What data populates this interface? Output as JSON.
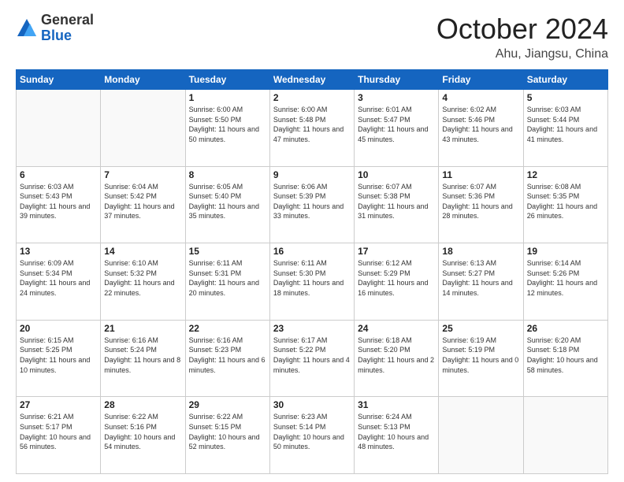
{
  "header": {
    "logo": {
      "general": "General",
      "blue": "Blue"
    },
    "title": "October 2024",
    "location": "Ahu, Jiangsu, China"
  },
  "weekdays": [
    "Sunday",
    "Monday",
    "Tuesday",
    "Wednesday",
    "Thursday",
    "Friday",
    "Saturday"
  ],
  "weeks": [
    [
      {
        "day": "",
        "info": ""
      },
      {
        "day": "",
        "info": ""
      },
      {
        "day": "1",
        "info": "Sunrise: 6:00 AM\nSunset: 5:50 PM\nDaylight: 11 hours and 50 minutes."
      },
      {
        "day": "2",
        "info": "Sunrise: 6:00 AM\nSunset: 5:48 PM\nDaylight: 11 hours and 47 minutes."
      },
      {
        "day": "3",
        "info": "Sunrise: 6:01 AM\nSunset: 5:47 PM\nDaylight: 11 hours and 45 minutes."
      },
      {
        "day": "4",
        "info": "Sunrise: 6:02 AM\nSunset: 5:46 PM\nDaylight: 11 hours and 43 minutes."
      },
      {
        "day": "5",
        "info": "Sunrise: 6:03 AM\nSunset: 5:44 PM\nDaylight: 11 hours and 41 minutes."
      }
    ],
    [
      {
        "day": "6",
        "info": "Sunrise: 6:03 AM\nSunset: 5:43 PM\nDaylight: 11 hours and 39 minutes."
      },
      {
        "day": "7",
        "info": "Sunrise: 6:04 AM\nSunset: 5:42 PM\nDaylight: 11 hours and 37 minutes."
      },
      {
        "day": "8",
        "info": "Sunrise: 6:05 AM\nSunset: 5:40 PM\nDaylight: 11 hours and 35 minutes."
      },
      {
        "day": "9",
        "info": "Sunrise: 6:06 AM\nSunset: 5:39 PM\nDaylight: 11 hours and 33 minutes."
      },
      {
        "day": "10",
        "info": "Sunrise: 6:07 AM\nSunset: 5:38 PM\nDaylight: 11 hours and 31 minutes."
      },
      {
        "day": "11",
        "info": "Sunrise: 6:07 AM\nSunset: 5:36 PM\nDaylight: 11 hours and 28 minutes."
      },
      {
        "day": "12",
        "info": "Sunrise: 6:08 AM\nSunset: 5:35 PM\nDaylight: 11 hours and 26 minutes."
      }
    ],
    [
      {
        "day": "13",
        "info": "Sunrise: 6:09 AM\nSunset: 5:34 PM\nDaylight: 11 hours and 24 minutes."
      },
      {
        "day": "14",
        "info": "Sunrise: 6:10 AM\nSunset: 5:32 PM\nDaylight: 11 hours and 22 minutes."
      },
      {
        "day": "15",
        "info": "Sunrise: 6:11 AM\nSunset: 5:31 PM\nDaylight: 11 hours and 20 minutes."
      },
      {
        "day": "16",
        "info": "Sunrise: 6:11 AM\nSunset: 5:30 PM\nDaylight: 11 hours and 18 minutes."
      },
      {
        "day": "17",
        "info": "Sunrise: 6:12 AM\nSunset: 5:29 PM\nDaylight: 11 hours and 16 minutes."
      },
      {
        "day": "18",
        "info": "Sunrise: 6:13 AM\nSunset: 5:27 PM\nDaylight: 11 hours and 14 minutes."
      },
      {
        "day": "19",
        "info": "Sunrise: 6:14 AM\nSunset: 5:26 PM\nDaylight: 11 hours and 12 minutes."
      }
    ],
    [
      {
        "day": "20",
        "info": "Sunrise: 6:15 AM\nSunset: 5:25 PM\nDaylight: 11 hours and 10 minutes."
      },
      {
        "day": "21",
        "info": "Sunrise: 6:16 AM\nSunset: 5:24 PM\nDaylight: 11 hours and 8 minutes."
      },
      {
        "day": "22",
        "info": "Sunrise: 6:16 AM\nSunset: 5:23 PM\nDaylight: 11 hours and 6 minutes."
      },
      {
        "day": "23",
        "info": "Sunrise: 6:17 AM\nSunset: 5:22 PM\nDaylight: 11 hours and 4 minutes."
      },
      {
        "day": "24",
        "info": "Sunrise: 6:18 AM\nSunset: 5:20 PM\nDaylight: 11 hours and 2 minutes."
      },
      {
        "day": "25",
        "info": "Sunrise: 6:19 AM\nSunset: 5:19 PM\nDaylight: 11 hours and 0 minutes."
      },
      {
        "day": "26",
        "info": "Sunrise: 6:20 AM\nSunset: 5:18 PM\nDaylight: 10 hours and 58 minutes."
      }
    ],
    [
      {
        "day": "27",
        "info": "Sunrise: 6:21 AM\nSunset: 5:17 PM\nDaylight: 10 hours and 56 minutes."
      },
      {
        "day": "28",
        "info": "Sunrise: 6:22 AM\nSunset: 5:16 PM\nDaylight: 10 hours and 54 minutes."
      },
      {
        "day": "29",
        "info": "Sunrise: 6:22 AM\nSunset: 5:15 PM\nDaylight: 10 hours and 52 minutes."
      },
      {
        "day": "30",
        "info": "Sunrise: 6:23 AM\nSunset: 5:14 PM\nDaylight: 10 hours and 50 minutes."
      },
      {
        "day": "31",
        "info": "Sunrise: 6:24 AM\nSunset: 5:13 PM\nDaylight: 10 hours and 48 minutes."
      },
      {
        "day": "",
        "info": ""
      },
      {
        "day": "",
        "info": ""
      }
    ]
  ]
}
